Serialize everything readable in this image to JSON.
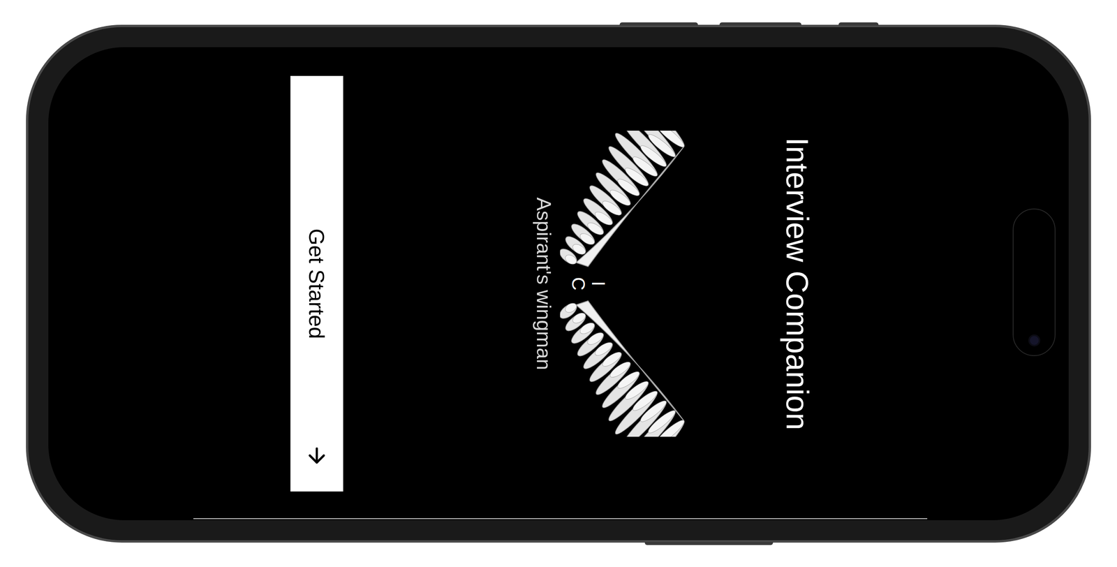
{
  "app": {
    "title": "Interview Companion",
    "logo": {
      "letters": [
        "I",
        "C"
      ],
      "tagline": "Aspirant's wingman"
    },
    "button": {
      "label": "Get Started"
    }
  }
}
